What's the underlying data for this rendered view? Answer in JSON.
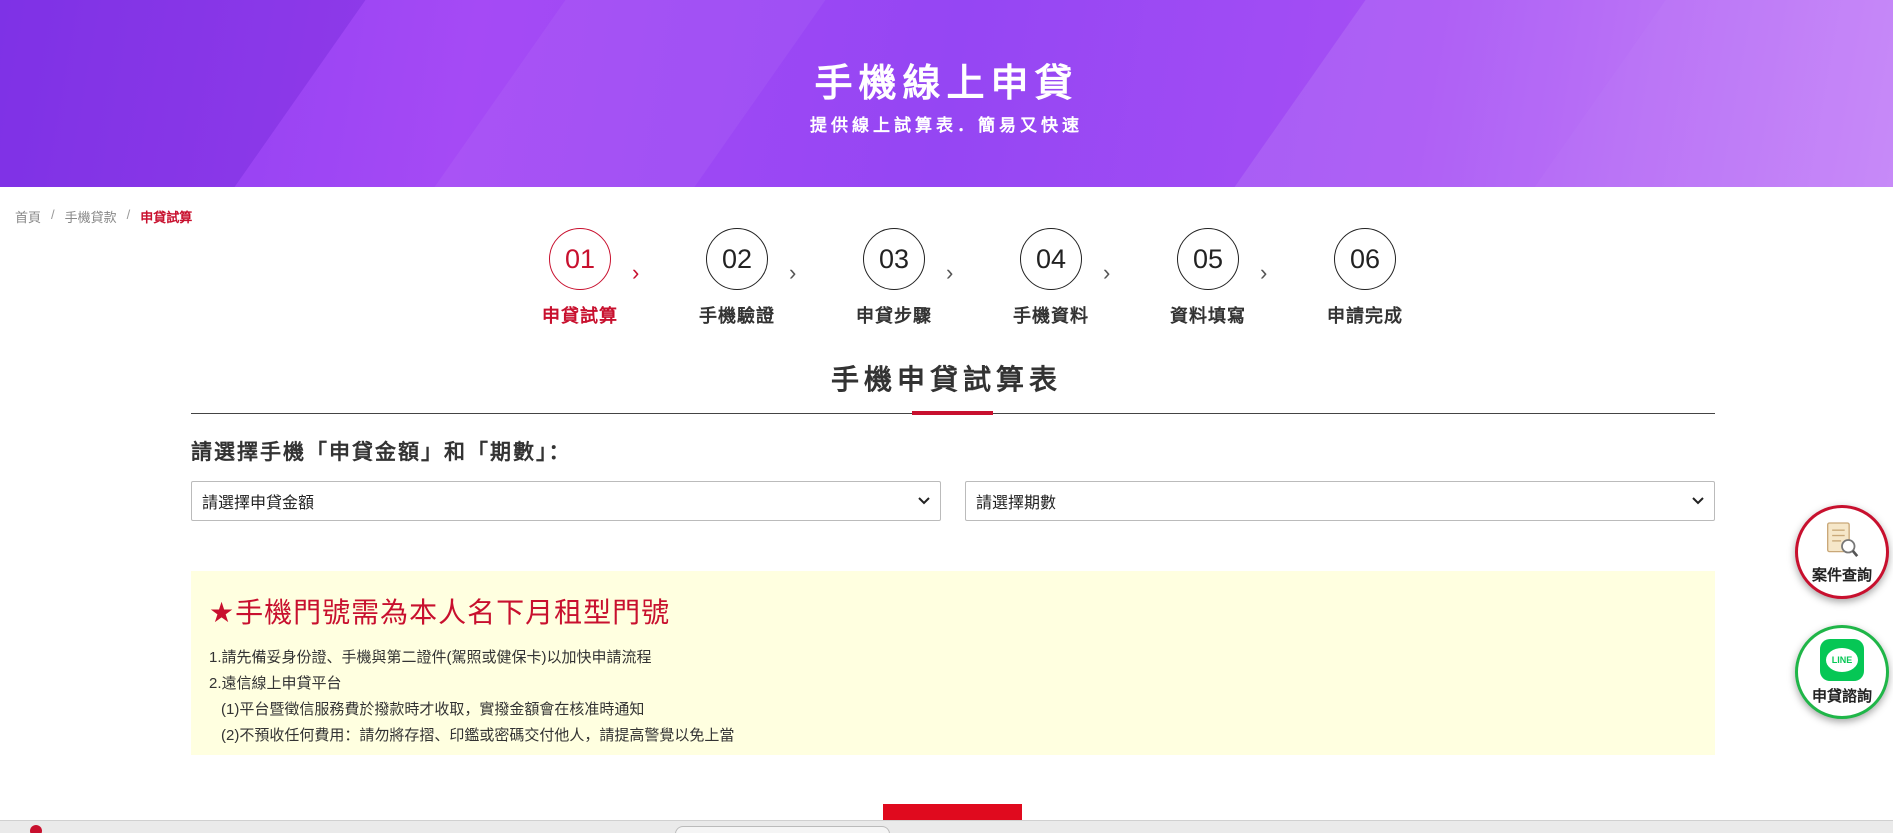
{
  "banner": {
    "title": "手機線上申貸",
    "subtitle": "提供線上試算表．簡易又快速"
  },
  "breadcrumb": {
    "items": [
      {
        "label": "首頁",
        "current": false
      },
      {
        "label": "手機貸款",
        "current": false
      },
      {
        "label": "申貸試算",
        "current": true
      }
    ],
    "separator": "/"
  },
  "steps": [
    {
      "number": "01",
      "label": "申貸試算",
      "active": true
    },
    {
      "number": "02",
      "label": "手機驗證",
      "active": false
    },
    {
      "number": "03",
      "label": "申貸步驟",
      "active": false
    },
    {
      "number": "04",
      "label": "手機資料",
      "active": false
    },
    {
      "number": "05",
      "label": "資料填寫",
      "active": false
    },
    {
      "number": "06",
      "label": "申請完成",
      "active": false
    }
  ],
  "step_separator": "›",
  "section": {
    "title": "手機申貸試算表",
    "prompt": "請選擇手機「申貸金額」和「期數」："
  },
  "selects": {
    "amount": {
      "value": "請選擇申貸金額"
    },
    "period": {
      "value": "請選擇期數"
    }
  },
  "notice": {
    "title": "★手機門號需為本人名下月租型門號",
    "lines": [
      "1.請先備妥身份證、手機與第二證件(駕照或健保卡)以加快申請流程",
      "2.遠信線上申貸平台",
      "(1)平台暨徵信服務費於撥款時才收取，實撥金額會在核准時通知",
      "(2)不預收任何費用：請勿將存摺、印鑑或密碼交付他人，請提高警覺以免上當"
    ]
  },
  "floating": {
    "case_query": "案件查詢",
    "line_consult": "申貸諮詢",
    "line_logo_text": "LINE"
  },
  "colors": {
    "accent": "#c8102e",
    "banner_purple": "#9546f3",
    "notice_bg": "#ffffe0",
    "line_green": "#06c755"
  }
}
